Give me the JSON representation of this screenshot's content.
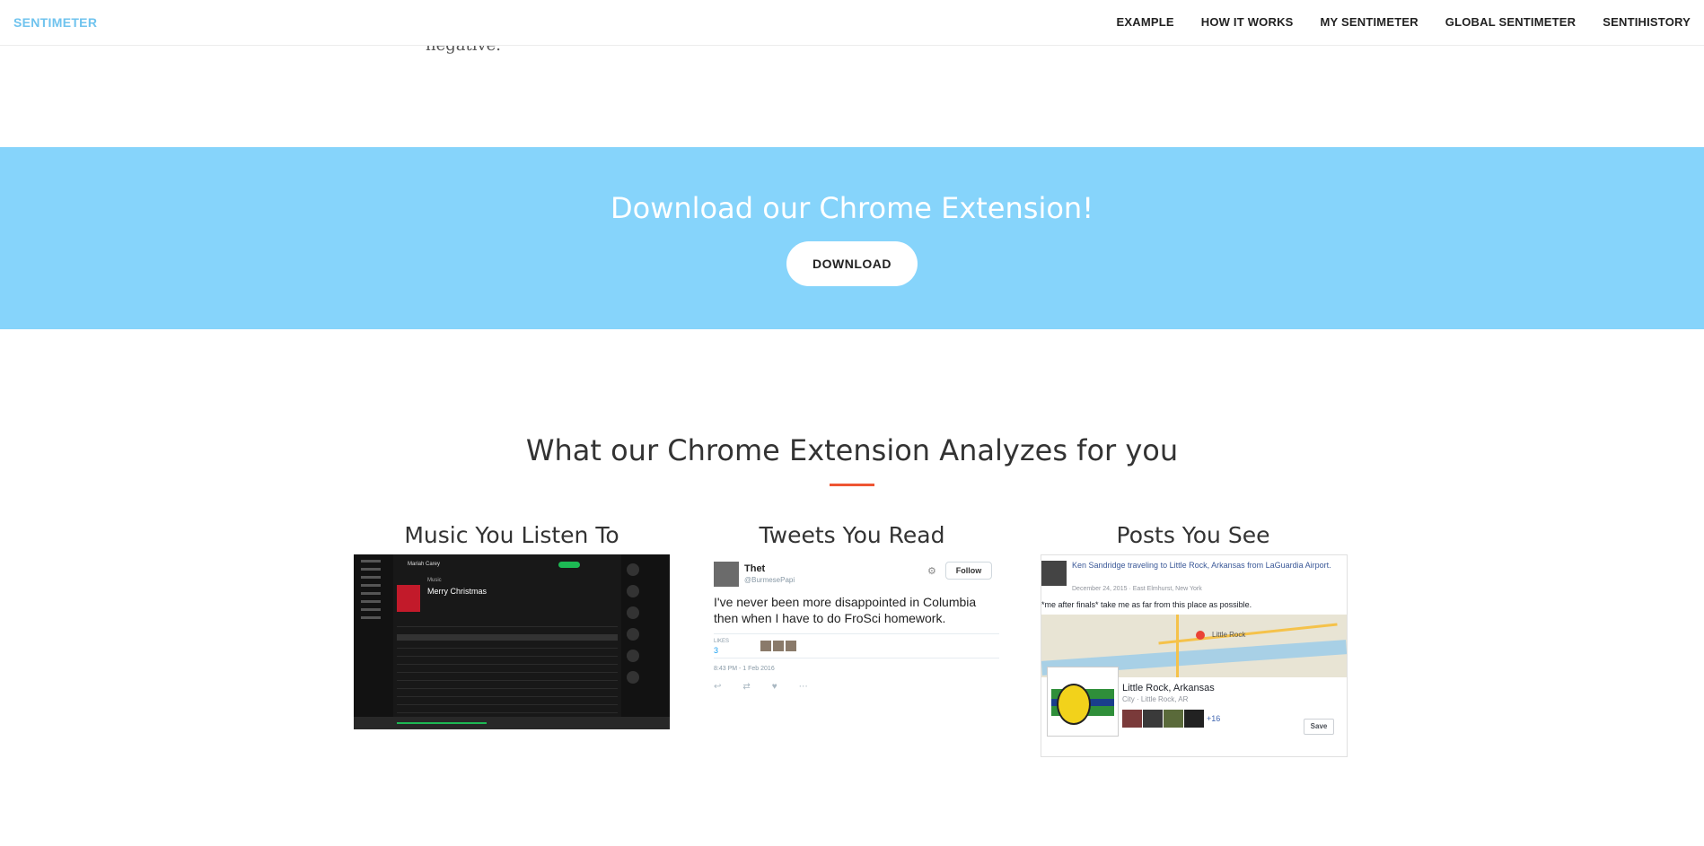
{
  "navbar": {
    "brand": "SENTIMETER",
    "links": [
      "EXAMPLE",
      "HOW IT WORKS",
      "MY SENTIMETER",
      "GLOBAL SENTIMETER",
      "SENTIHISTORY"
    ]
  },
  "snippet": "negative.",
  "cta": {
    "heading": "Download our Chrome Extension!",
    "button": "DOWNLOAD",
    "background": "#86d4fb"
  },
  "features": {
    "title": "What our Chrome Extension Analyzes for you",
    "accent": "#ee5533",
    "items": [
      {
        "title": "Music You Listen To",
        "app": {
          "artist": "Mariah Carey",
          "sub": "Music",
          "album": "Merry Christmas"
        }
      },
      {
        "title": "Tweets You Read",
        "app": {
          "name": "Thet",
          "handle": "@BurmesePapi",
          "follow": "Follow",
          "text": "I've never been more disappointed in Columbia then when I have to do FroSci homework.",
          "likes_label": "LIKES",
          "likes": "3",
          "time": "8:43 PM - 1 Feb 2016"
        }
      },
      {
        "title": "Posts You See",
        "app": {
          "header": "Ken Sandridge traveling to Little Rock, Arkansas from LaGuardia Airport.",
          "meta": "December 24, 2015 · East Elmhurst, New York",
          "body": "*me after finals* take me as far from this place as possible.",
          "map_label": "Little Rock",
          "place": "Little Rock, Arkansas",
          "city": "City · Little Rock, AR",
          "more": "+16",
          "save": "Save"
        }
      }
    ]
  }
}
